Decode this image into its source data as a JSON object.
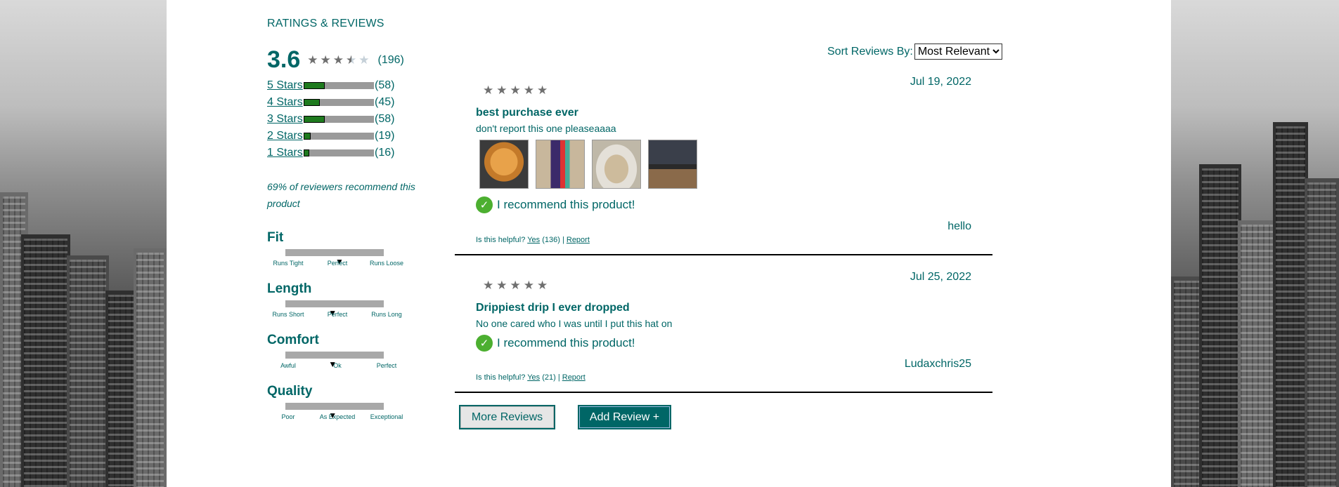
{
  "section_title": "RATINGS & REVIEWS",
  "rating": {
    "average": "3.6",
    "average_value": 3.6,
    "total_count": "(196)"
  },
  "breakdown": [
    {
      "label": "5 Stars",
      "count": "(58)",
      "fraction": 0.3
    },
    {
      "label": "4 Stars",
      "count": "(45)",
      "fraction": 0.23
    },
    {
      "label": "3 Stars",
      "count": "(58)",
      "fraction": 0.3
    },
    {
      "label": "2 Stars",
      "count": "(19)",
      "fraction": 0.1
    },
    {
      "label": "1 Stars",
      "count": "(16)",
      "fraction": 0.08
    }
  ],
  "recommend_text": "69% of reviewers recommend this product",
  "characteristics": [
    {
      "name": "Fit",
      "labels": [
        "Runs Tight",
        "Perfect",
        "Runs Loose"
      ],
      "value": 0.55
    },
    {
      "name": "Length",
      "labels": [
        "Runs Short",
        "Perfect",
        "Runs Long"
      ],
      "value": 0.48
    },
    {
      "name": "Comfort",
      "labels": [
        "Awful",
        "Ok",
        "Perfect"
      ],
      "value": 0.48
    },
    {
      "name": "Quality",
      "labels": [
        "Poor",
        "As Expected",
        "Exceptional"
      ],
      "value": 0.48
    }
  ],
  "sort": {
    "label": "Sort Reviews By:",
    "selected": "Most Relevant"
  },
  "reviews": [
    {
      "date": "Jul 19, 2022",
      "summary": "best purchase ever",
      "body": "don't report this one pleaseaaaa",
      "recommend": "I recommend this product!",
      "user": "hello",
      "helpful_prefix": "Is this helpful?",
      "yes": "Yes",
      "yes_count": "(136)",
      "separator": "|",
      "report": "Report"
    },
    {
      "date": "Jul 25, 2022",
      "summary": "Drippiest drip I ever dropped",
      "body": "No one cared who I was until I put this hat on",
      "recommend": "I recommend this product!",
      "user": "Ludaxchris25",
      "helpful_prefix": "Is this helpful?",
      "yes": "Yes",
      "yes_count": "(21)",
      "separator": "|",
      "report": "Report"
    }
  ],
  "buttons": {
    "more": "More Reviews",
    "add": "Add Review +"
  },
  "icons": {
    "star": "star-icon",
    "check": "check-circle-icon",
    "marker": "triangle-down-icon"
  },
  "colors": {
    "accent": "#006666",
    "bar_fill": "#1e7a1e",
    "check": "#4caf30"
  }
}
